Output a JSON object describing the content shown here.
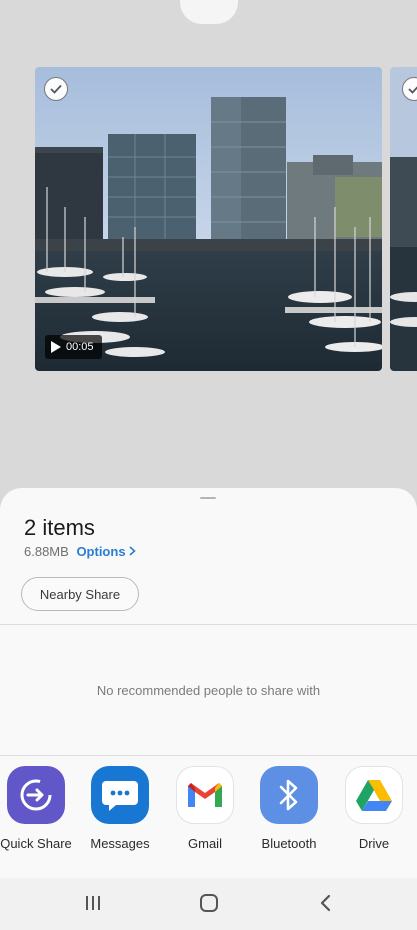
{
  "preview": {
    "duration": "00:05"
  },
  "share_sheet": {
    "title": "2 items",
    "size": "6.88MB",
    "options_label": "Options",
    "nearby_share_label": "Nearby Share",
    "no_people_message": "No recommended people to share with",
    "apps": [
      {
        "label": "Quick Share",
        "icon": "quick-share-icon",
        "color": "#6257c9"
      },
      {
        "label": "Messages",
        "icon": "messages-icon",
        "color": "#1877d2"
      },
      {
        "label": "Gmail",
        "icon": "gmail-icon",
        "color": "#ffffff"
      },
      {
        "label": "Bluetooth",
        "icon": "bluetooth-icon",
        "color": "#5d8fe4"
      },
      {
        "label": "Drive",
        "icon": "drive-icon",
        "color": "#ffffff"
      }
    ]
  },
  "colors": {
    "accent_link": "#2a7dd1",
    "sheet_background": "#f9f9f9",
    "backdrop": "#d9d9d9"
  }
}
